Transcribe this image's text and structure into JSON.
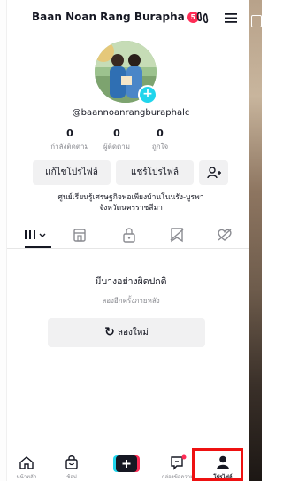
{
  "header": {
    "title": "Baan Noan Rang Burapha",
    "notification_count": "5"
  },
  "profile": {
    "username": "@baannoanrangburaphalc",
    "stats": [
      {
        "value": "0",
        "label": "กำลังติดตาม"
      },
      {
        "value": "0",
        "label": "ผู้ติดตาม"
      },
      {
        "value": "0",
        "label": "ถูกใจ"
      }
    ],
    "edit_button": "แก้ไขโปรไฟล์",
    "share_button": "แชร์โปรไฟล์",
    "bio_line1": "ศูนย์เรียนรู้เศรษฐกิจพอเพียงบ้านโนนรัง-บูรพา",
    "bio_line2": "จังหวัดนครราชสีมา"
  },
  "error": {
    "title": "มีบางอย่างผิดปกติ",
    "subtitle": "ลองอีกครั้งภายหลัง",
    "retry_label": "ลองใหม่"
  },
  "bottom_nav": {
    "home": "หน้าหลัก",
    "shop": "ช้อป",
    "inbox": "กล่องข้อความ",
    "profile": "โปรไฟล์"
  },
  "colors": {
    "accent_red": "#fe2c55",
    "add_badge": "#20d5ec",
    "highlight_box": "#ee1111"
  }
}
